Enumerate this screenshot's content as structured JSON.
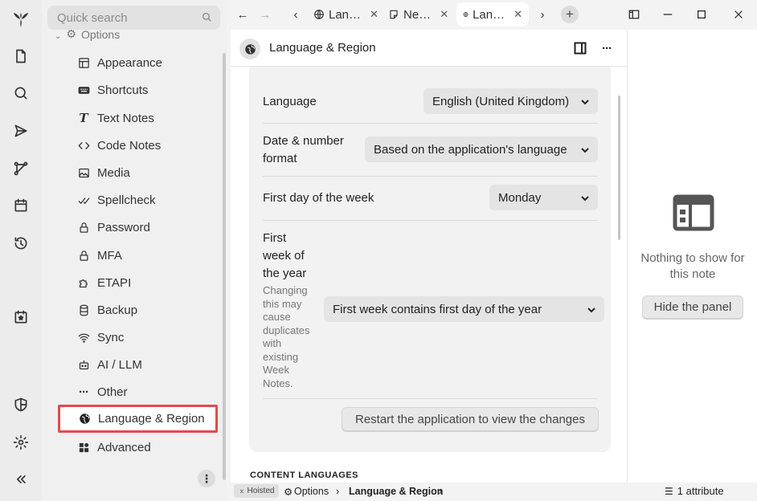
{
  "launcher": {
    "items": [
      "logo-icon",
      "new-note-icon",
      "search-icon",
      "send-icon",
      "graph-icon",
      "calendar-icon",
      "history-icon",
      "today-icon",
      "shield-icon",
      "settings-icon",
      "collapse-icon"
    ]
  },
  "tree": {
    "search_placeholder": "Quick search",
    "partial_item": "Options",
    "items": [
      {
        "label": "Appearance",
        "icon": "appearance-icon"
      },
      {
        "label": "Shortcuts",
        "icon": "keyboard-icon"
      },
      {
        "label": "Text Notes",
        "icon": "text-icon"
      },
      {
        "label": "Code Notes",
        "icon": "code-icon"
      },
      {
        "label": "Media",
        "icon": "image-icon"
      },
      {
        "label": "Spellcheck",
        "icon": "spellcheck-icon"
      },
      {
        "label": "Password",
        "icon": "lock-icon"
      },
      {
        "label": "MFA",
        "icon": "lock-icon"
      },
      {
        "label": "ETAPI",
        "icon": "puzzle-icon"
      },
      {
        "label": "Backup",
        "icon": "database-icon"
      },
      {
        "label": "Sync",
        "icon": "wifi-icon"
      },
      {
        "label": "AI / LLM",
        "icon": "robot-icon"
      },
      {
        "label": "Other",
        "icon": "dots-icon"
      },
      {
        "label": "Language & Region",
        "icon": "globe-icon",
        "active": true
      },
      {
        "label": "Advanced",
        "icon": "grid-icon"
      }
    ],
    "menu_label": "⋮"
  },
  "tabs": [
    {
      "label": "Lan…",
      "icon": "globe-icon",
      "close": "✕"
    },
    {
      "label": "Ne…",
      "icon": "note-icon",
      "close": "✕"
    },
    {
      "label": "Lan…",
      "icon": "globe-icon",
      "close": "✕",
      "active": true
    }
  ],
  "tabbar": {
    "back": "←",
    "forward": "→",
    "scroll_left": "‹",
    "scroll_right": "›",
    "plus": "+"
  },
  "note": {
    "title": "Language & Region",
    "icon": "globe-icon"
  },
  "settings": {
    "language_label": "Language",
    "language_value": "English (United Kingdom)",
    "date_label_1": "Date & number",
    "date_label_2": "format",
    "date_value": "Based on the application's language",
    "first_day_label": "First day of the week",
    "first_day_value": "Monday",
    "first_week_label": [
      "First",
      "week of",
      "the year"
    ],
    "first_week_help": [
      "Changing",
      "this may",
      "cause",
      "duplicates",
      "with",
      "existing",
      "Week",
      "Notes."
    ],
    "first_week_value": "First week contains first day of the year",
    "restart_button": "Restart the application to view the changes"
  },
  "section_heading": "CONTENT LANGUAGES",
  "right_panel": {
    "empty_text_1": "Nothing to show for",
    "empty_text_2": "this note",
    "hide_button": "Hide the panel"
  },
  "statusbar": {
    "hoisted": "Hoisted",
    "crumb_1": "Options",
    "crumb_2": "Language & Region",
    "separator": "›",
    "attributes": "1 attribute"
  },
  "colors": {
    "highlight_border": "#e5484d",
    "select_bg": "#e4e4e4",
    "card_bg": "#f2f2f2"
  }
}
